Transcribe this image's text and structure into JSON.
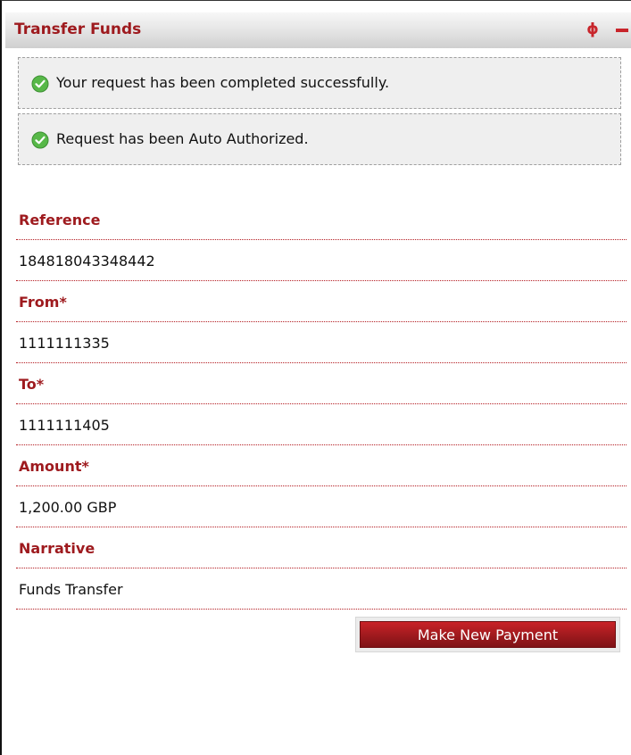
{
  "panel": {
    "title": "Transfer Funds",
    "refresh_glyph": "ϕ",
    "accent_color": "#9e1a1e"
  },
  "messages": [
    {
      "icon": "check-circle-icon",
      "text": "Your request has been completed successfully."
    },
    {
      "icon": "check-circle-icon",
      "text": "Request has been Auto Authorized."
    }
  ],
  "fields": [
    {
      "label": "Reference",
      "value": "184818043348442"
    },
    {
      "label": "From*",
      "value": "1111111335"
    },
    {
      "label": "To*",
      "value": "1111111405"
    },
    {
      "label": "Amount*",
      "value": "1,200.00 GBP"
    },
    {
      "label": "Narrative",
      "value": "Funds Transfer"
    }
  ],
  "actions": {
    "make_new_payment_label": "Make New Payment"
  }
}
